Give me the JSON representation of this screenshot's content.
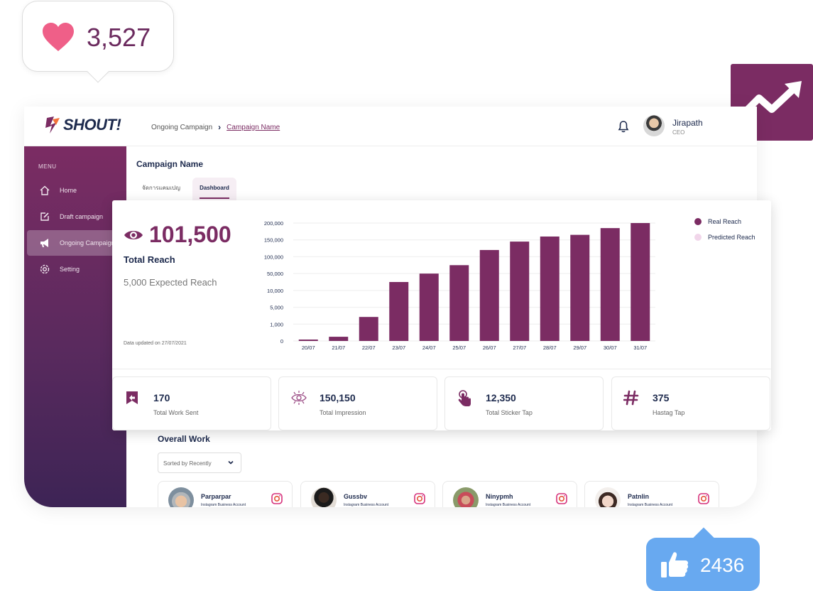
{
  "heart_bubble": {
    "count": "3,527"
  },
  "like_bubble": {
    "count": "2436"
  },
  "topbar": {
    "logo": "SHOUT!",
    "breadcrumb": [
      "Ongoing Campaign",
      "Campaign Name"
    ],
    "user": {
      "name": "Jirapath",
      "role": "CEO"
    }
  },
  "sidebar": {
    "menu_label": "MENU",
    "items": [
      {
        "label": "Home",
        "icon": "home-icon"
      },
      {
        "label": "Draft campaign",
        "icon": "edit-icon"
      },
      {
        "label": "Ongoing Campaign",
        "icon": "megaphone-icon",
        "active": true
      },
      {
        "label": "Setting",
        "icon": "gear-icon"
      }
    ]
  },
  "main": {
    "title": "Campaign Name",
    "tabs": [
      {
        "label": "จัดการแคมเปญ"
      },
      {
        "label": "Dashboard",
        "active": true
      }
    ],
    "overall_title": "Overall Work",
    "sort_label": "Sorted by Recently",
    "works": [
      {
        "name": "Parparpar",
        "account": "Instagram Business Account"
      },
      {
        "name": "Gussbv",
        "account": "Instagram Business Account"
      },
      {
        "name": "Ninypmh",
        "account": "Instagram Business Account"
      },
      {
        "name": "Patnlin",
        "account": "Instagram Business Account"
      }
    ]
  },
  "dashboard": {
    "total_reach": "101,500",
    "total_reach_label": "Total Reach",
    "expected_reach": "5,000  Expected Reach",
    "updated": "Data updated on 27/07/2021",
    "legend": [
      {
        "name": "Real Reach",
        "color": "#7b2c63"
      },
      {
        "name": "Predicted Reach",
        "color": "#f1d6ea"
      }
    ],
    "stats": [
      {
        "value": "170",
        "label": "Total Work Sent",
        "icon": "send-work-icon"
      },
      {
        "value": "150,150",
        "label": "Total Impression",
        "icon": "eye-outline-icon"
      },
      {
        "value": "12,350",
        "label": "Total Sticker Tap",
        "icon": "tap-icon"
      },
      {
        "value": "375",
        "label": "Hastag Tap",
        "icon": "hashtag-icon"
      }
    ]
  },
  "chart_data": {
    "type": "bar",
    "title": "",
    "xlabel": "",
    "ylabel": "",
    "categories": [
      "20/07",
      "21/07",
      "22/07",
      "23/07",
      "24/07",
      "25/07",
      "26/07",
      "27/07",
      "28/07",
      "29/07",
      "30/07",
      "31/07"
    ],
    "y_tick_labels": [
      "0",
      "1,000",
      "5,000",
      "10,000",
      "50,000",
      "100,000",
      "150,000",
      "200,000"
    ],
    "series": [
      {
        "name": "Real Reach",
        "values": [
          0,
          250,
          2700,
          30000,
          50000,
          75000,
          120000,
          145000,
          160000,
          165000,
          185000,
          210000
        ]
      }
    ],
    "note_scale": "non-linear axis; y tick labels evenly spaced"
  }
}
